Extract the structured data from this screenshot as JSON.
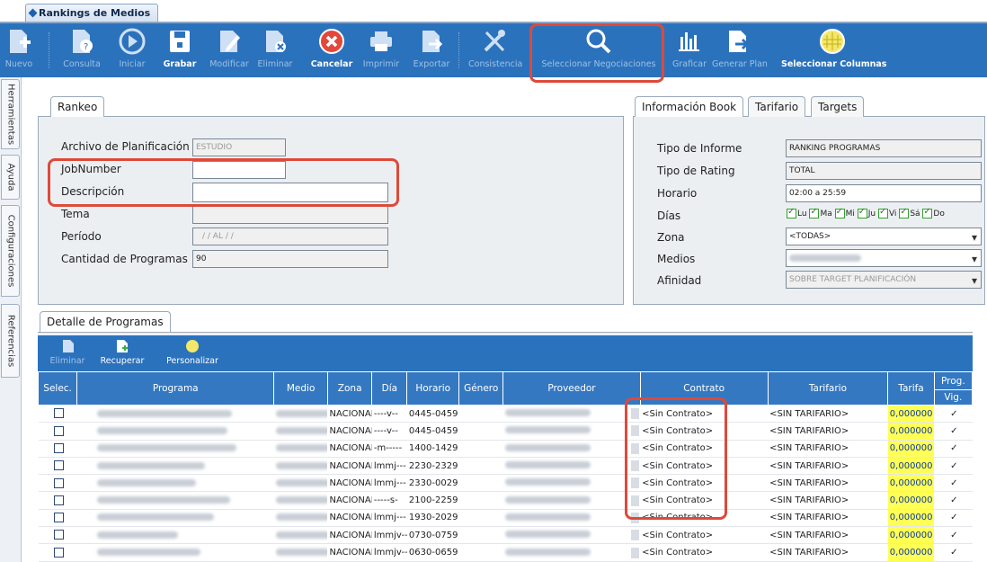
{
  "app_tab": "Rankings de Medios",
  "toolbar": [
    {
      "label": "Nuevo",
      "icon": "new-doc-icon",
      "enabled": false
    },
    {
      "label": "Consulta",
      "icon": "query-doc-icon",
      "enabled": false
    },
    {
      "label": "Iniciar",
      "icon": "play-icon",
      "enabled": false
    },
    {
      "label": "Grabar",
      "icon": "save-icon",
      "enabled": true
    },
    {
      "label": "Modificar",
      "icon": "edit-icon",
      "enabled": false
    },
    {
      "label": "Eliminar",
      "icon": "delete-doc-icon",
      "enabled": false
    },
    {
      "label": "Cancelar",
      "icon": "cancel-icon",
      "enabled": true
    },
    {
      "label": "Imprimir",
      "icon": "printer-icon",
      "enabled": false
    },
    {
      "label": "Exportar",
      "icon": "export-icon",
      "enabled": false
    },
    {
      "label": "Consistencia",
      "icon": "tools-icon",
      "enabled": false
    },
    {
      "label": "Seleccionar Negociaciones",
      "icon": "search-icon",
      "enabled": false
    },
    {
      "label": "Graficar",
      "icon": "chart-icon",
      "enabled": false
    },
    {
      "label": "Generar Plan",
      "icon": "generate-plan-icon",
      "enabled": false
    },
    {
      "label": "Seleccionar Columnas",
      "icon": "columns-icon",
      "enabled": true
    }
  ],
  "sidebar": [
    "Herramientas",
    "Ayuda",
    "Configuraciones",
    "Referencias"
  ],
  "rankeo": {
    "tab": "Rankeo",
    "archivo_label": "Archivo de Planificación",
    "archivo_value": "ESTUDIO",
    "job_label": "JobNumber",
    "job_value": "",
    "desc_label": "Descripción",
    "desc_value": "",
    "tema_label": "Tema",
    "tema_value": "",
    "periodo_label": "Período",
    "periodo_value": "/ /   AL  / /",
    "cantidad_label": "Cantidad de Programas",
    "cantidad_value": "90"
  },
  "info": {
    "tabs": [
      "Información Book",
      "Tarifario",
      "Targets"
    ],
    "tipo_informe_label": "Tipo de Informe",
    "tipo_informe_value": "RANKING PROGRAMAS",
    "tipo_rating_label": "Tipo de Rating",
    "tipo_rating_value": "TOTAL",
    "horario_label": "Horario",
    "horario_value": "02:00 a 25:59",
    "dias_label": "Días",
    "dias": [
      "Lu",
      "Ma",
      "Mi",
      "Ju",
      "Vi",
      "Sá",
      "Do"
    ],
    "zona_label": "Zona",
    "zona_value": "<TODAS>",
    "medios_label": "Medios",
    "afinidad_label": "Afinidad",
    "afinidad_value": "SOBRE TARGET PLANIFICACIÓN"
  },
  "detalle": {
    "tab": "Detalle de Programas",
    "tools": [
      {
        "label": "Eliminar",
        "icon": "delete-icon",
        "enabled": false
      },
      {
        "label": "Recuperar",
        "icon": "recover-icon",
        "enabled": true
      },
      {
        "label": "Personalizar",
        "icon": "customize-icon",
        "enabled": true
      }
    ],
    "headers": [
      "Selec.",
      "Programa",
      "Medio",
      "Zona",
      "Día",
      "Horario",
      "Género",
      "Proveedor",
      "Contrato",
      "Tarifario",
      "Tarifa",
      "Prog."
    ],
    "header_sub": "Vig.",
    "rows": [
      {
        "zona": "NACIONAL",
        "dia": "----v--",
        "horario": "0445-0459",
        "contrato": "<Sin Contrato>",
        "tarifario": "<SIN TARIFARIO>",
        "tarifa": "0,000000"
      },
      {
        "zona": "NACIONAL",
        "dia": "----v--",
        "horario": "0445-0459",
        "contrato": "<Sin Contrato>",
        "tarifario": "<SIN TARIFARIO>",
        "tarifa": "0,000000"
      },
      {
        "zona": "NACIONAL",
        "dia": "-m-----",
        "horario": "1400-1429",
        "contrato": "<Sin Contrato>",
        "tarifario": "<SIN TARIFARIO>",
        "tarifa": "0,000000"
      },
      {
        "zona": "NACIONAL",
        "dia": "lmmj---",
        "horario": "2230-2329",
        "contrato": "<Sin Contrato>",
        "tarifario": "<SIN TARIFARIO>",
        "tarifa": "0,000000"
      },
      {
        "zona": "NACIONAL",
        "dia": "lmmj---",
        "horario": "2330-0029",
        "contrato": "<Sin Contrato>",
        "tarifario": "<SIN TARIFARIO>",
        "tarifa": "0,000000"
      },
      {
        "zona": "NACIONAL",
        "dia": "-----s-",
        "horario": "2100-2259",
        "contrato": "<Sin Contrato>",
        "tarifario": "<SIN TARIFARIO>",
        "tarifa": "0,000000"
      },
      {
        "zona": "NACIONAL",
        "dia": "lmmj---",
        "horario": "1930-2029",
        "contrato": "<Sin Contrato>",
        "tarifario": "<SIN TARIFARIO>",
        "tarifa": "0,000000"
      },
      {
        "zona": "NACIONAL",
        "dia": "lmmjv--",
        "horario": "0730-0759",
        "contrato": "<Sin Contrato>",
        "tarifario": "<SIN TARIFARIO>",
        "tarifa": "0,000000"
      },
      {
        "zona": "NACIONAL",
        "dia": "lmmjv--",
        "horario": "0630-0659",
        "contrato": "<Sin Contrato>",
        "tarifario": "<SIN TARIFARIO>",
        "tarifa": "0,000000"
      }
    ]
  },
  "colors": {
    "toolbar": "#2b72bd",
    "highlight": "#dd4a3a",
    "tarifa_bg": "#ffff55"
  }
}
